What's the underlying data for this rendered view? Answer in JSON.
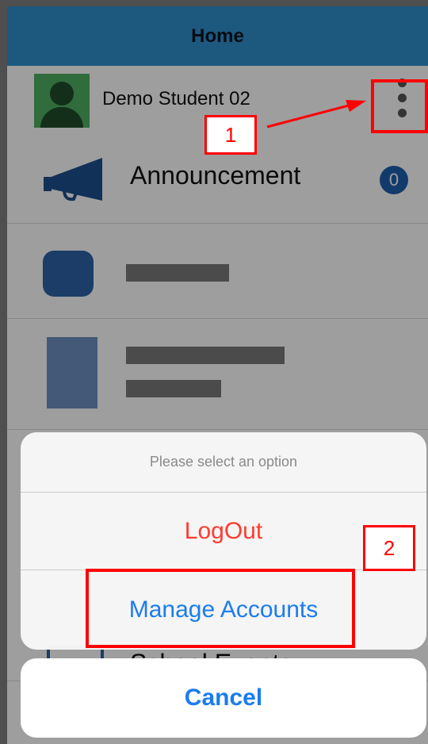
{
  "navbar": {
    "title": "Home"
  },
  "account": {
    "name": "Demo Student 02"
  },
  "menu": {
    "announcement_label": "Announcement",
    "announcement_count": "0",
    "events_label": "School Events"
  },
  "action_sheet": {
    "title": "Please select an option",
    "logout_label": "LogOut",
    "manage_label": "Manage Accounts",
    "cancel_label": "Cancel"
  },
  "annotations": {
    "label_1": "1",
    "label_2": "2"
  },
  "colors": {
    "navbar": "#2f8ecb",
    "destructive": "#ff3b30",
    "action_blue": "#1a7cf0",
    "annotation_red": "#ff0000",
    "badge": "#1e5fae"
  },
  "icons": {
    "avatar": "user-avatar-icon",
    "more": "more-vertical-icon",
    "announcement": "megaphone-icon",
    "events": "calendar-icon"
  }
}
